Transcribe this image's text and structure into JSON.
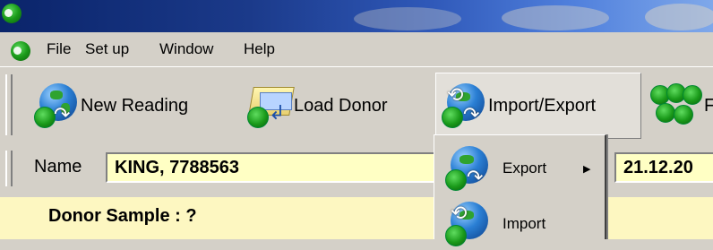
{
  "window": {
    "logo_icon": "app-logo-icon"
  },
  "menubar": {
    "items": [
      "File",
      "Set up",
      "Window",
      "Help"
    ]
  },
  "toolbar": {
    "new_reading": "New Reading",
    "load_donor": "Load Donor",
    "import_export": "Import/Export",
    "partial_label": "F"
  },
  "form": {
    "name_label": "Name",
    "name_value": "KING, 7788563",
    "date_value": "21.12.20"
  },
  "donor": {
    "label": "Donor Sample : ?"
  },
  "dropdown": {
    "export_label": "Export",
    "import_label": "Import",
    "submenu_arrow": "▶"
  },
  "colors": {
    "field_bg": "#ffffc4",
    "donor_bg": "#fdf7c1",
    "titlebar": "#0a246a"
  }
}
